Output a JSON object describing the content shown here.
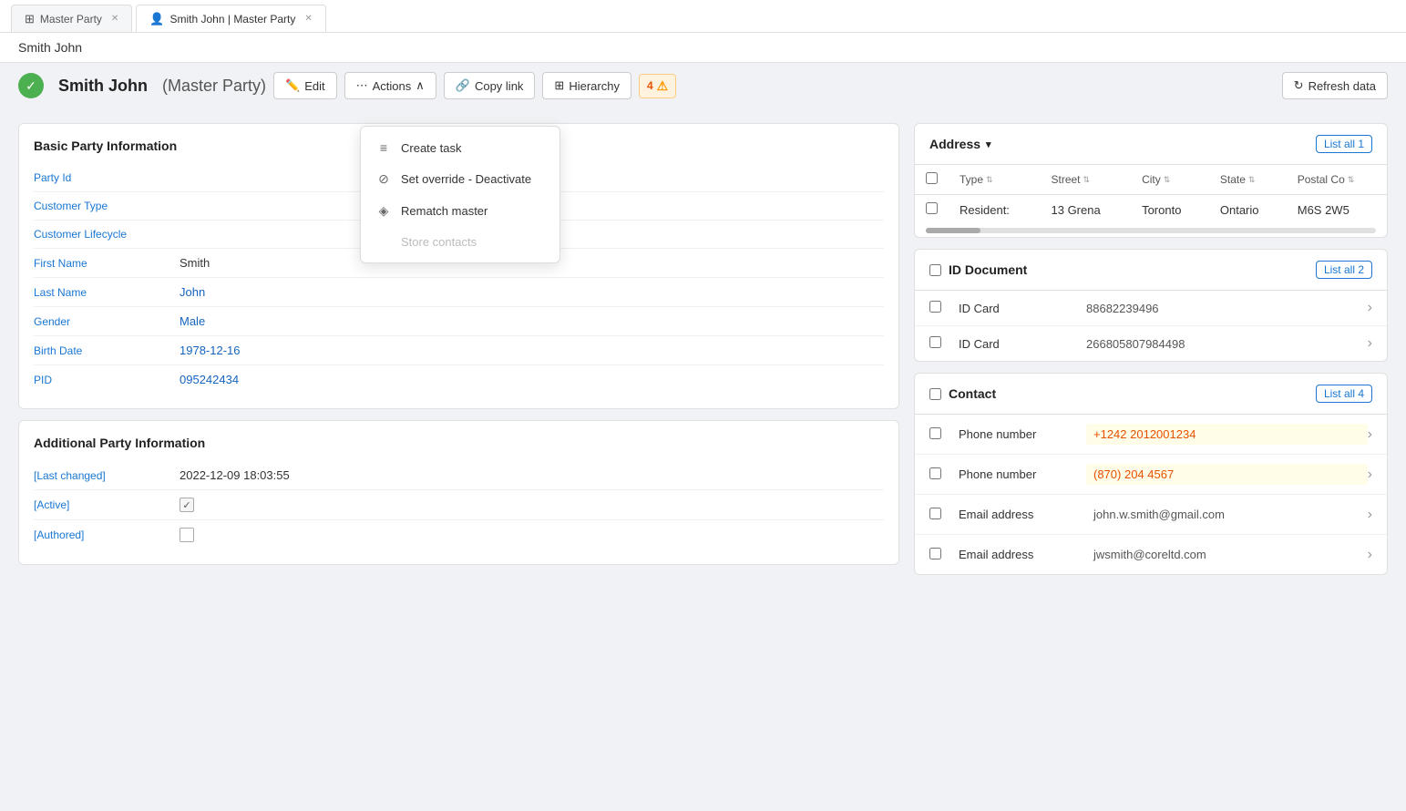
{
  "tabs": [
    {
      "id": "master-party",
      "label": "Master Party",
      "active": false,
      "icon": "grid-icon"
    },
    {
      "id": "smith-john",
      "label": "Smith John | Master Party",
      "active": true,
      "icon": "person-icon"
    }
  ],
  "page_header": {
    "title": "Smith John"
  },
  "toolbar": {
    "status_icon": "✓",
    "record_name": "Smith John",
    "record_type": "(Master Party)",
    "edit_label": "Edit",
    "actions_label": "Actions",
    "copy_label": "Copy link",
    "hierarchy_label": "Hierarchy",
    "badge_count": "4",
    "refresh_label": "Refresh data"
  },
  "actions_menu": {
    "items": [
      {
        "id": "create-task",
        "label": "Create task",
        "icon": "list-icon",
        "disabled": false
      },
      {
        "id": "set-override",
        "label": "Set override - Deactivate",
        "icon": "block-icon",
        "disabled": false
      },
      {
        "id": "rematch-master",
        "label": "Rematch master",
        "icon": "diamond-icon",
        "disabled": false
      },
      {
        "id": "store-contacts",
        "label": "Store contacts",
        "icon": "",
        "disabled": true
      }
    ]
  },
  "basic_party_info": {
    "title": "Basic Party Information",
    "fields": [
      {
        "label": "Party Id",
        "value": "",
        "type": "text"
      },
      {
        "label": "Customer Type",
        "value": "",
        "type": "text"
      },
      {
        "label": "Customer Lifecycle",
        "value": "",
        "type": "text"
      },
      {
        "label": "First Name",
        "value": "Smith",
        "type": "text"
      },
      {
        "label": "Last Name",
        "value": "John",
        "type": "text"
      },
      {
        "label": "Gender",
        "value": "Male",
        "type": "text"
      },
      {
        "label": "Birth Date",
        "value": "1978-12-16",
        "type": "text"
      },
      {
        "label": "PID",
        "value": "095242434",
        "type": "text"
      }
    ]
  },
  "additional_party_info": {
    "title": "Additional Party Information",
    "fields": [
      {
        "label": "[Last changed]",
        "value": "2022-12-09 18:03:55",
        "type": "text"
      },
      {
        "label": "[Active]",
        "value": "✓",
        "type": "checkbox",
        "checked": true
      },
      {
        "label": "[Authored]",
        "value": "",
        "type": "checkbox",
        "checked": false
      }
    ]
  },
  "address": {
    "title": "Address",
    "list_all": "List all 1",
    "columns": [
      "Type",
      "Street",
      "City",
      "State",
      "Postal Co"
    ],
    "rows": [
      {
        "type": "Resident:",
        "street": "13 Grena",
        "city": "Toronto",
        "state": "Ontario",
        "postal": "M6S 2W5"
      }
    ]
  },
  "id_document": {
    "title": "ID Document",
    "list_all": "List all 2",
    "rows": [
      {
        "type": "ID Card",
        "number": "88682239496"
      },
      {
        "type": "ID Card",
        "number": "266805807984498"
      }
    ]
  },
  "contact": {
    "title": "Contact",
    "list_all": "List all 4",
    "rows": [
      {
        "type": "Phone number",
        "value": "+1242 2012001234",
        "highlight": true
      },
      {
        "type": "Phone number",
        "value": "(870) 204 4567",
        "highlight": true
      },
      {
        "type": "Email address",
        "value": "john.w.smith@gmail.com",
        "highlight": false
      },
      {
        "type": "Email address",
        "value": "jwsmith@coreltd.com",
        "highlight": false
      }
    ]
  }
}
